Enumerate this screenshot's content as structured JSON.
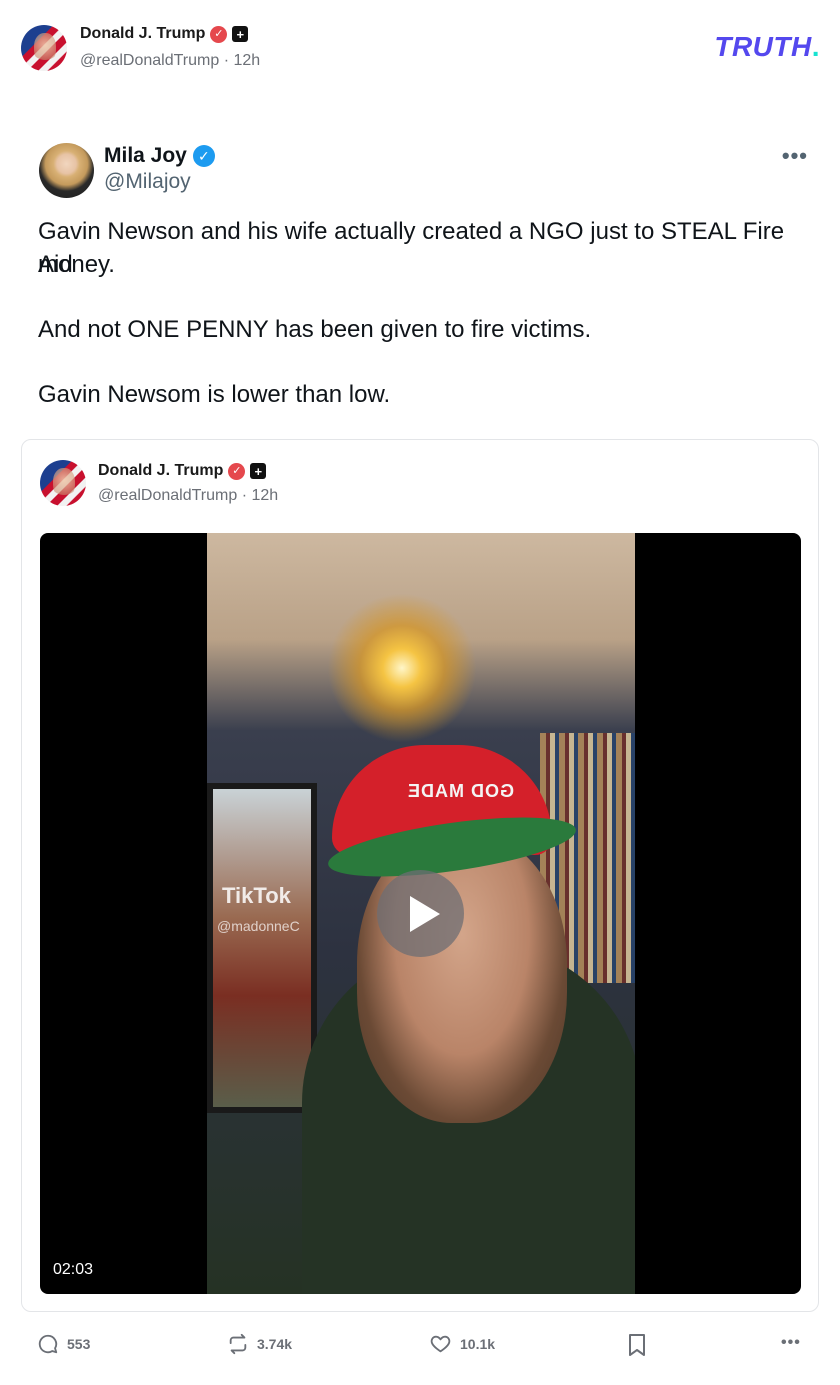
{
  "header": {
    "name": "Donald J. Trump",
    "handle": "@realDonaldTrump",
    "time_sep": "·",
    "time": "12h",
    "verified_color": "#e5484d",
    "logo_text": "TRUTH",
    "logo_dot": ".",
    "logo_color": "#5448ee",
    "logo_dot_color": "#17e3d1"
  },
  "embedded_post": {
    "name": "Mila Joy",
    "handle": "@Milajoy",
    "verified_color": "#1d9bf0",
    "more_label": "•••",
    "lines": [
      "Gavin Newson and his wife actually created a NGO just to STEAL Fire Aid",
      "money.",
      "And not ONE PENNY has been given to fire victims.",
      "Gavin Newsom is lower than low."
    ]
  },
  "quoted_truth": {
    "name": "Donald J. Trump",
    "handle": "@realDonaldTrump",
    "time_sep": "·",
    "time": "12h",
    "video": {
      "duration": "02:03",
      "watermark": "TikTok",
      "watermark_sub": "@madonneC",
      "cap_text": "GOD MADE"
    }
  },
  "actions": {
    "replies": "553",
    "retruths": "3.74k",
    "likes": "10.1k",
    "more_label": "•••"
  }
}
